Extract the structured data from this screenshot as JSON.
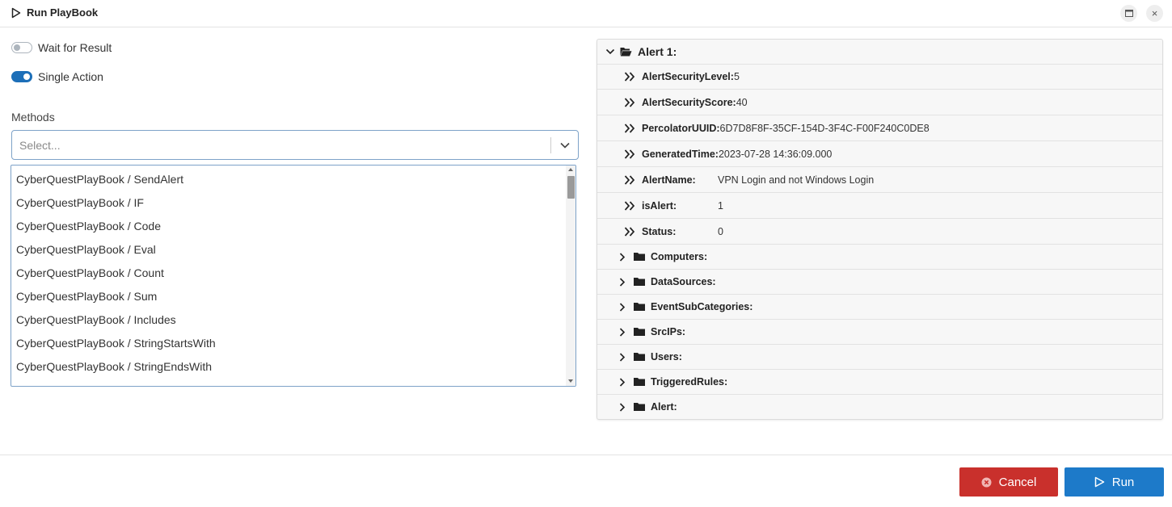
{
  "window": {
    "title": "Run PlayBook",
    "icons": {
      "title": "play-icon",
      "maximize": "maximize-icon",
      "close": "close-icon"
    },
    "close_glyph": "×"
  },
  "options": {
    "wait_for_result": {
      "label": "Wait for Result",
      "checked": false
    },
    "single_action": {
      "label": "Single Action",
      "checked": true
    }
  },
  "methods": {
    "label": "Methods",
    "placeholder": "Select...",
    "items": [
      "CyberQuestPlayBook / SendAlert",
      "CyberQuestPlayBook / IF",
      "CyberQuestPlayBook / Code",
      "CyberQuestPlayBook / Eval",
      "CyberQuestPlayBook / Count",
      "CyberQuestPlayBook / Sum",
      "CyberQuestPlayBook / Includes",
      "CyberQuestPlayBook / StringStartsWith",
      "CyberQuestPlayBook / StringEndsWith"
    ]
  },
  "tree": {
    "root_label": "Alert 1:",
    "fields": [
      {
        "key": "AlertSecurityLevel:",
        "value": "5",
        "inline": true
      },
      {
        "key": "AlertSecurityScore:",
        "value": "40",
        "inline": true
      },
      {
        "key": "PercolatorUUID:",
        "value": "6D7D8F8F-35CF-154D-3F4C-F00F240C0DE8",
        "inline": true
      },
      {
        "key": "GeneratedTime:",
        "value": "2023-07-28 14:36:09.000",
        "inline": true
      },
      {
        "key": "AlertName:",
        "value": "VPN Login and not Windows Login",
        "inline": false
      },
      {
        "key": "isAlert:",
        "value": "1",
        "inline": false
      },
      {
        "key": "Status:",
        "value": "0",
        "inline": false
      }
    ],
    "folders": [
      "Computers:",
      "DataSources:",
      "EventSubCategories:",
      "SrcIPs:",
      "Users:",
      "TriggeredRules:",
      "Alert:"
    ]
  },
  "footer": {
    "cancel_label": "Cancel",
    "run_label": "Run"
  },
  "colors": {
    "primary": "#1d7ac9",
    "danger": "#c9302c",
    "toggle_on": "#1d6fb8"
  }
}
